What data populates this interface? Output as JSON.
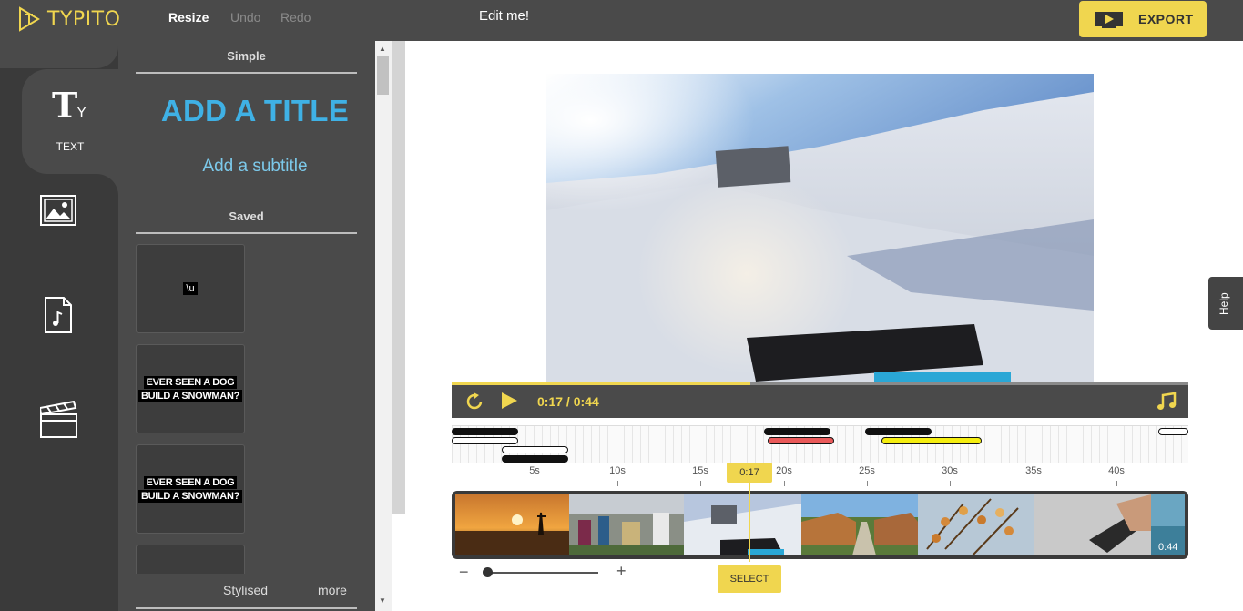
{
  "app": {
    "logo": "TYPITO"
  },
  "toolbar": {
    "resize": "Resize",
    "undo": "Undo",
    "redo": "Redo",
    "project_title": "Edit me!",
    "export": "EXPORT"
  },
  "colors": {
    "accent": "#f0d64f",
    "topbar": "#4a4a4a",
    "rail": "#3a3a3a",
    "title_blue": "#3fb1e5"
  },
  "rail": {
    "items": [
      {
        "icon": "text-icon",
        "label": "TEXT",
        "active": true
      },
      {
        "icon": "image-icon"
      },
      {
        "icon": "music-file-icon"
      },
      {
        "icon": "clapperboard-icon"
      }
    ]
  },
  "text_panel": {
    "simple_header": "Simple",
    "add_title": "ADD A TITLE",
    "add_subtitle": "Add a subtitle",
    "saved_header": "Saved",
    "saved_items": [
      {
        "text": "\\u"
      },
      {
        "line1": "EVER SEEN A DOG",
        "line2": "BUILD A SNOWMAN?"
      },
      {
        "line1": "EVER SEEN A DOG",
        "line2": "BUILD A SNOWMAN?"
      }
    ],
    "tabs": {
      "stylised": "Stylised",
      "more": "more"
    }
  },
  "player": {
    "current_time": "0:17",
    "separator": "/",
    "total_time": "0:44",
    "progress_fraction": 0.405
  },
  "timeline": {
    "ticks": [
      "5s",
      "10s",
      "15s",
      "20s",
      "25s",
      "30s",
      "35s",
      "40s"
    ],
    "playhead_label": "0:17",
    "duration_label": "0:44",
    "select_label": "SELECT",
    "zoom": {
      "minus": "−",
      "plus": "+"
    }
  },
  "help": {
    "label": "Help"
  }
}
